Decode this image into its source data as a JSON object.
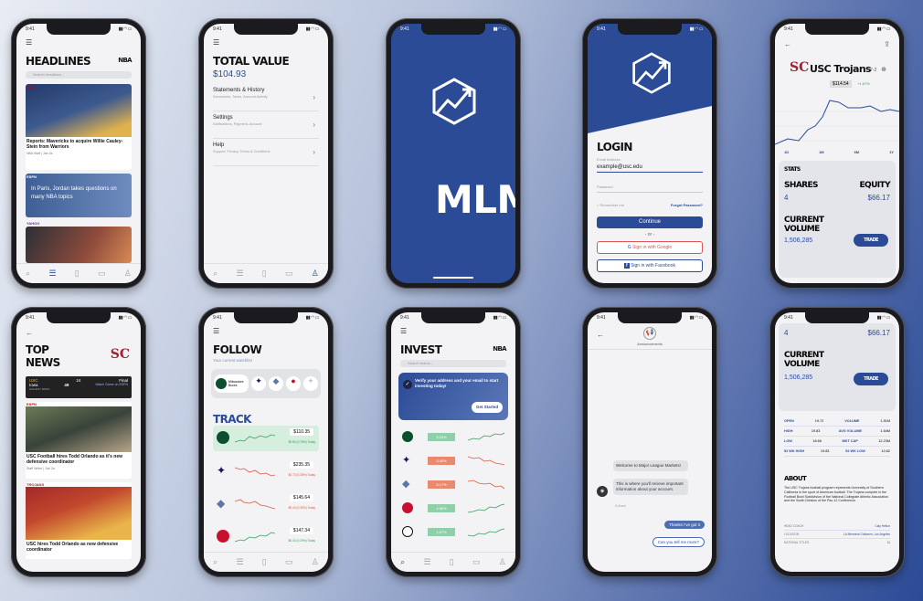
{
  "status_time": "9:41",
  "phones": {
    "headlines": {
      "title": "HEADLINES",
      "logo": "NBA",
      "search_placeholder": "Search headlines...",
      "article1": {
        "source": "ESPN",
        "caption": "Reports: Mavericks to acquire Willie Cauley-Stein from Warriors",
        "meta": "NBA Staff | Jan 2a"
      },
      "article2": {
        "source": "ESPN",
        "caption": "In Paris, Jordan takes questions on many NBA topics"
      },
      "article3": {
        "source": "YAHOO"
      },
      "nav": [
        "search",
        "list",
        "bookmark",
        "chat",
        "user"
      ]
    },
    "total_value": {
      "title": "TOTAL VALUE",
      "amount": "$104.93",
      "menu": [
        {
          "title": "Statements & History",
          "sub": "Documents, Taxes, Account Activity"
        },
        {
          "title": "Settings",
          "sub": "Notifications, Payment, Account"
        },
        {
          "title": "Help",
          "sub": "Support, Privacy, Terms & Conditions"
        }
      ]
    },
    "splash": {
      "brand": "MLM",
      "bg": "#2c4b96"
    },
    "login": {
      "title": "LOGIN",
      "email_label": "Email Address",
      "email_value": "example@usc.edu",
      "password_label": "Password",
      "remember": "Remember me",
      "forgot": "Forgot Password?",
      "continue": "Continue",
      "or": "- or -",
      "google": "Sign in with Google",
      "facebook": "Sign in with Facebook"
    },
    "team": {
      "name": "USC Trojans",
      "record": "7-2",
      "price": "$114.54",
      "change": "+1.67%",
      "range_tabs": [
        "1D",
        "1M",
        "6M",
        "1Y"
      ],
      "stats_label": "STATS",
      "shares_label": "SHARES",
      "shares_value": "4",
      "equity_label": "EQUITY",
      "equity_value": "$66.17",
      "volume_label_1": "CURRENT",
      "volume_label_2": "VOLUME",
      "volume_value": "1,506,285",
      "trade": "TRADE"
    },
    "top_news": {
      "title_1": "TOP",
      "title_2": "NEWS",
      "score_team_1": "USC",
      "score_team_2": "Iowa",
      "score_1": "24",
      "score_2": "49",
      "score_status": "Final",
      "score_watch": "Watch Game on ESPN",
      "score_footer": "HOLIDAY BOWL",
      "article1": {
        "source": "ESPN",
        "caption": "USC Football hires Todd Orlando as it's new defensive coordinator",
        "meta": "Staff Writer | Jan 2a"
      },
      "article2": {
        "source": "TROJANS",
        "caption": "USC hires Todd Orlando as new defensive coordinator"
      }
    },
    "follow": {
      "title": "FOLLOW",
      "subtitle": "Your current watchlist",
      "chip_name_1": "Milwaukee",
      "chip_name_2": "Bucks",
      "track_title": "TRACK",
      "rows": [
        {
          "price": "$110.35",
          "change": "$0.84 (0.76%) Today",
          "dir": "up"
        },
        {
          "price": "$235.35",
          "change": "$0.73 (0.35%) Today",
          "dir": "down"
        },
        {
          "price": "$145.64",
          "change": "$0.43 (0.30%) Today",
          "dir": "down"
        },
        {
          "price": "$147.34",
          "change": "$0.43 (0.29%) Today",
          "dir": "up"
        }
      ]
    },
    "invest": {
      "title": "INVEST",
      "logo": "NBA",
      "search_placeholder": "Search teams...",
      "banner_text": "Verify your address and your email to start investing today!",
      "banner_button": "Get Started",
      "rows": [
        {
          "badge": "5.15%",
          "dir": "up"
        },
        {
          "badge": "3.45%",
          "dir": "down"
        },
        {
          "badge": "8.17%",
          "dir": "down"
        },
        {
          "badge": "4.56%",
          "dir": "up"
        },
        {
          "badge": "1.67%",
          "dir": "up"
        }
      ]
    },
    "chat": {
      "channel": "Announcements",
      "msg1": "Welcome to Major League Markets!",
      "msg2": "This is where you'll recieve important information about your account.",
      "msg_time": "9:41am",
      "reply1": "Thanks I've got it",
      "reply2": "Can you tell me more?"
    },
    "team_detail": {
      "shares_value": "4",
      "equity_value": "$66.17",
      "volume_label_1": "CURRENT",
      "volume_label_2": "VOLUME",
      "volume_value": "1,506,285",
      "trade": "TRADE",
      "stats": [
        {
          "k1": "OPEN",
          "v1": "19.72",
          "k2": "VOLUME",
          "v2": "1.51M"
        },
        {
          "k1": "HIGH",
          "v1": "19.83",
          "k2": "AVG VOLUME",
          "v2": "1.64M"
        },
        {
          "k1": "LOW",
          "v1": "18.66",
          "k2": "MKT CAP",
          "v2": "12.23M"
        },
        {
          "k1": "52 WK HIGH",
          "v1": "19.83",
          "k2": "52 WK LOW",
          "v2": "10.62"
        }
      ],
      "about_title": "ABOUT",
      "about_text": "The USC Trojans football program represents University of Southern California in the sport of American football. The Trojans compete in the Football Bowl Subdivision of the National Collegiate Athletic Association and the South Division of the Pac-12 Conference.",
      "facts": [
        {
          "k": "HEAD COACH",
          "v": "Clay Helton"
        },
        {
          "k": "LOCATION",
          "v": "LA Memorial Coliseum, Los Angeles"
        },
        {
          "k": "NATIONAL TITLES",
          "v": "11"
        }
      ]
    }
  }
}
